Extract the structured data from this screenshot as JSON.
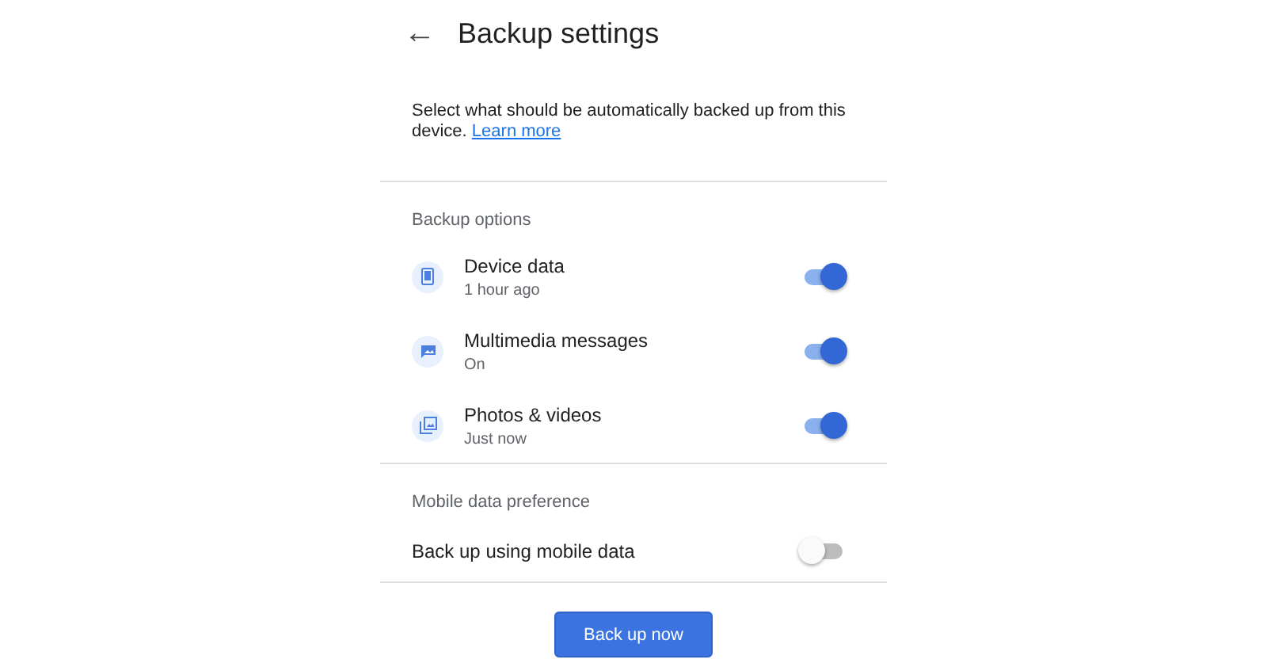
{
  "header": {
    "back_icon": "←",
    "title": "Backup settings"
  },
  "description": {
    "text": "Select what should be automatically backed up from this device.",
    "link": "Learn more"
  },
  "sections": [
    {
      "heading": "Backup options",
      "items": [
        {
          "kind": "device",
          "title": "Device data",
          "subtitle": "1 hour ago",
          "on": true
        },
        {
          "kind": "messages",
          "title": "Multimedia messages",
          "subtitle": "On",
          "on": true
        },
        {
          "kind": "photos",
          "title": "Photos & videos",
          "subtitle": "Just now",
          "on": true
        }
      ]
    },
    {
      "heading": "Mobile data preference",
      "items": [
        {
          "kind": "plain",
          "title": "Back up using mobile data",
          "on": false
        }
      ]
    }
  ],
  "button": "Back up now"
}
